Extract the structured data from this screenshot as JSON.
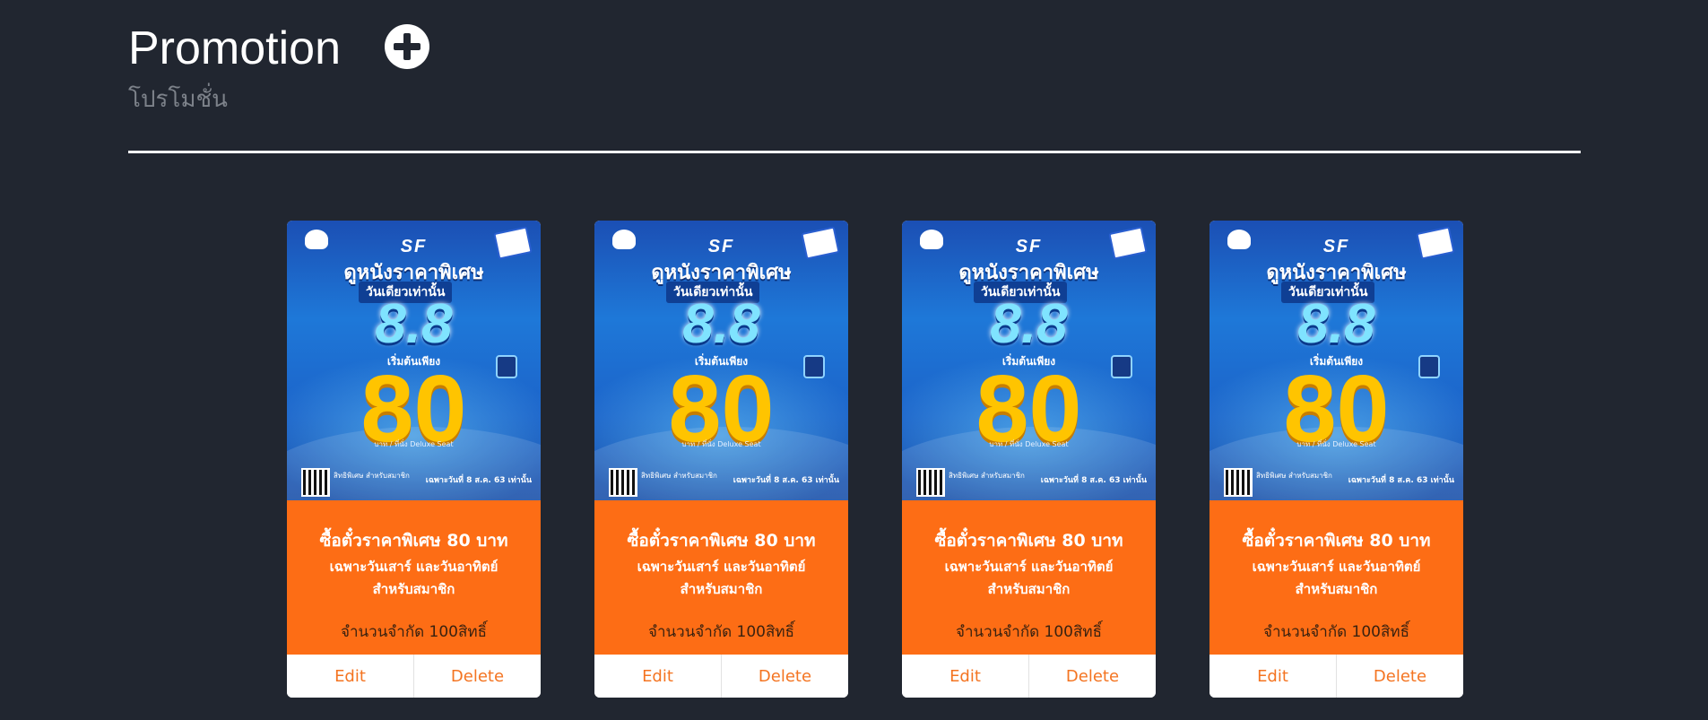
{
  "page": {
    "title": "Promotion",
    "subtitle": "โปรโมชั่น",
    "add_icon": "plus-circle-icon"
  },
  "colors": {
    "background": "#212630",
    "card_accent": "#fd6d15",
    "action_text": "#f47421",
    "poster_blue": "#1e78d8",
    "poster_yellow": "#ffc400"
  },
  "promotions": [
    {
      "poster": {
        "logo": "SF",
        "headline": "ดูหนังราคาพิเศษ",
        "sub": "วันเดียวเท่านั้น",
        "big_date": "8.8",
        "start": "เริ่มต้นเพียง",
        "price": "80",
        "fine": "บาท / ที่นั่ง Deluxe Seat",
        "member": "สิทธิพิเศษ สำหรับสมาชิก",
        "date_note": "เฉพาะวันที่ 8 ส.ค. 63 เท่านั้น"
      },
      "title": "ซื้อตั๋วราคาพิเศษ 80 บาท",
      "line2": "เฉพาะวันเสาร์ และวันอาทิตย์",
      "line3": "สำหรับสมาชิก",
      "limit": "จำนวนจำกัด 100สิทธิ์",
      "edit": "Edit",
      "delete": "Delete"
    },
    {
      "poster": {
        "logo": "SF",
        "headline": "ดูหนังราคาพิเศษ",
        "sub": "วันเดียวเท่านั้น",
        "big_date": "8.8",
        "start": "เริ่มต้นเพียง",
        "price": "80",
        "fine": "บาท / ที่นั่ง Deluxe Seat",
        "member": "สิทธิพิเศษ สำหรับสมาชิก",
        "date_note": "เฉพาะวันที่ 8 ส.ค. 63 เท่านั้น"
      },
      "title": "ซื้อตั๋วราคาพิเศษ 80 บาท",
      "line2": "เฉพาะวันเสาร์ และวันอาทิตย์",
      "line3": "สำหรับสมาชิก",
      "limit": "จำนวนจำกัด 100สิทธิ์",
      "edit": "Edit",
      "delete": "Delete"
    },
    {
      "poster": {
        "logo": "SF",
        "headline": "ดูหนังราคาพิเศษ",
        "sub": "วันเดียวเท่านั้น",
        "big_date": "8.8",
        "start": "เริ่มต้นเพียง",
        "price": "80",
        "fine": "บาท / ที่นั่ง Deluxe Seat",
        "member": "สิทธิพิเศษ สำหรับสมาชิก",
        "date_note": "เฉพาะวันที่ 8 ส.ค. 63 เท่านั้น"
      },
      "title": "ซื้อตั๋วราคาพิเศษ 80 บาท",
      "line2": "เฉพาะวันเสาร์ และวันอาทิตย์",
      "line3": "สำหรับสมาชิก",
      "limit": "จำนวนจำกัด 100สิทธิ์",
      "edit": "Edit",
      "delete": "Delete"
    },
    {
      "poster": {
        "logo": "SF",
        "headline": "ดูหนังราคาพิเศษ",
        "sub": "วันเดียวเท่านั้น",
        "big_date": "8.8",
        "start": "เริ่มต้นเพียง",
        "price": "80",
        "fine": "บาท / ที่นั่ง Deluxe Seat",
        "member": "สิทธิพิเศษ สำหรับสมาชิก",
        "date_note": "เฉพาะวันที่ 8 ส.ค. 63 เท่านั้น"
      },
      "title": "ซื้อตั๋วราคาพิเศษ 80 บาท",
      "line2": "เฉพาะวันเสาร์ และวันอาทิตย์",
      "line3": "สำหรับสมาชิก",
      "limit": "จำนวนจำกัด 100สิทธิ์",
      "edit": "Edit",
      "delete": "Delete"
    }
  ]
}
